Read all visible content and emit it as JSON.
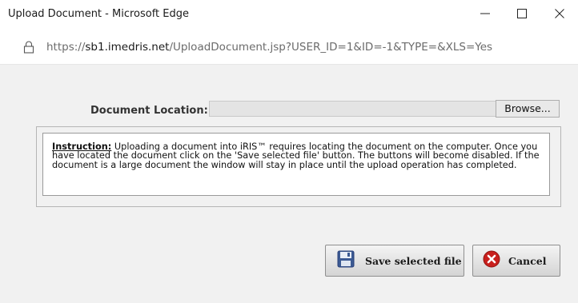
{
  "window": {
    "title": "Upload Document - Microsoft Edge",
    "minimize_glyph": "—",
    "maximize_glyph": "☐",
    "close_glyph": "✕"
  },
  "address": {
    "scheme": "https://",
    "host": "sb1.imedris.net",
    "path": "/UploadDocument.jsp?USER_ID=1&ID=-1&TYPE=&XLS=Yes",
    "icon": "lock-icon"
  },
  "form": {
    "location_label": "Document Location:",
    "file_value": "",
    "browse_label": "Browse..."
  },
  "instruction": {
    "heading": "Instruction:",
    "body": "Uploading a document into iRIS™ requires locating the document on the computer. Once you have located the document click on the 'Save selected file' button. The buttons will become disabled. If the document is a large document the window will stay in place until the upload operation has completed."
  },
  "buttons": {
    "save_label": "Save selected file",
    "save_icon": "floppy-disk-icon",
    "cancel_label": "Cancel",
    "cancel_icon": "cancel-icon"
  },
  "colors": {
    "cancel_red": "#c8201d",
    "save_blue": "#3c5a93"
  }
}
